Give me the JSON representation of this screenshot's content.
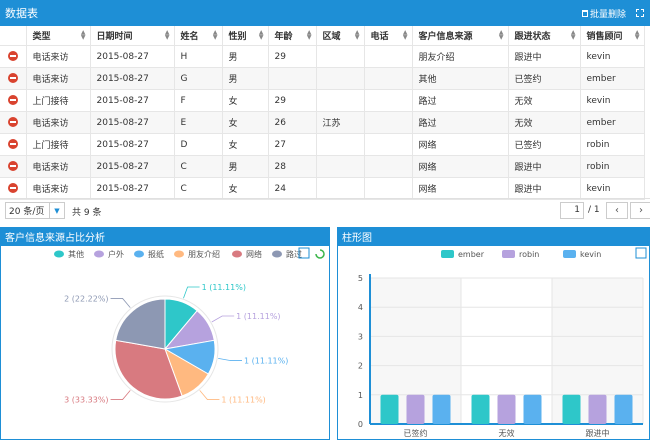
{
  "header": {
    "title": "数据表",
    "batch_delete": "批量删除"
  },
  "table": {
    "columns": [
      "类型",
      "日期时间",
      "姓名",
      "性别",
      "年龄",
      "区域",
      "电话",
      "客户信息来源",
      "跟进状态",
      "销售顾问"
    ],
    "rows": [
      [
        "电话来访",
        "2015-08-27",
        "H",
        "男",
        "29",
        "",
        "",
        "朋友介绍",
        "跟进中",
        "kevin"
      ],
      [
        "电话来访",
        "2015-08-27",
        "G",
        "男",
        "",
        "",
        "",
        "其他",
        "已签约",
        "ember"
      ],
      [
        "上门接待",
        "2015-08-27",
        "F",
        "女",
        "29",
        "",
        "",
        "路过",
        "无效",
        "kevin"
      ],
      [
        "电话来访",
        "2015-08-27",
        "E",
        "女",
        "26",
        "江苏",
        "",
        "路过",
        "无效",
        "ember"
      ],
      [
        "上门接待",
        "2015-08-27",
        "D",
        "女",
        "27",
        "",
        "",
        "网络",
        "已签约",
        "robin"
      ],
      [
        "电话来访",
        "2015-08-27",
        "C",
        "男",
        "28",
        "",
        "",
        "网络",
        "跟进中",
        "robin"
      ],
      [
        "电话来访",
        "2015-08-27",
        "C",
        "女",
        "24",
        "",
        "",
        "网络",
        "跟进中",
        "kevin"
      ]
    ]
  },
  "pager": {
    "page_size": "20 条/页",
    "total": "共 9 条",
    "current_page": "1",
    "total_pages": "/ 1",
    "prev": "‹",
    "next": "›"
  },
  "pie_panel": {
    "title": "客户信息来源占比分析"
  },
  "bar_panel": {
    "title": "柱形图"
  },
  "chart_data": [
    {
      "type": "pie",
      "legend": [
        "其他",
        "户外",
        "报纸",
        "朋友介绍",
        "网络",
        "路过"
      ],
      "slices": [
        {
          "name": "其他",
          "value": 1,
          "label": "1 (11.11%)",
          "color": "#2ec7c9"
        },
        {
          "name": "户外",
          "value": 1,
          "label": "1 (11.11%)",
          "color": "#b6a2de"
        },
        {
          "name": "报纸",
          "value": 1,
          "label": "1 (11.11%)",
          "color": "#5ab1ef"
        },
        {
          "name": "朋友介绍",
          "value": 1,
          "label": "1 (11.11%)",
          "color": "#ffb980"
        },
        {
          "name": "网络",
          "value": 3,
          "label": "3 (33.33%)",
          "color": "#d87a80"
        },
        {
          "name": "路过",
          "value": 2,
          "label": "2 (22.22%)",
          "color": "#8d98b3"
        }
      ]
    },
    {
      "type": "bar",
      "categories": [
        "已签约",
        "无效",
        "跟进中"
      ],
      "series": [
        {
          "name": "ember",
          "values": [
            1,
            1,
            1
          ],
          "color": "#2ec7c9"
        },
        {
          "name": "robin",
          "values": [
            1,
            1,
            1
          ],
          "color": "#b6a2de"
        },
        {
          "name": "kevin",
          "values": [
            1,
            1,
            1
          ],
          "color": "#5ab1ef"
        }
      ],
      "yticks": [
        "0",
        "1",
        "2",
        "3",
        "4",
        "5"
      ],
      "ylim": [
        0,
        5
      ]
    }
  ]
}
